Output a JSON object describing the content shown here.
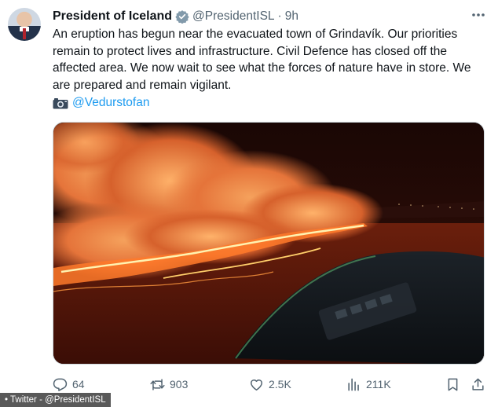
{
  "author": {
    "name": "President of Iceland",
    "handle": "@PresidentISL",
    "separator": "·",
    "time": "9h"
  },
  "tweet": {
    "text": "An eruption has begun near the evacuated town of Grindavík. Our priorities remain to protect lives and infrastructure. Civil Defence has closed off the affected area. We now wait to see what the forces of nature have in store. We are prepared and remain vigilant.",
    "photo_credit": "@Vedurstofan"
  },
  "actions": {
    "replies": "64",
    "reposts": "903",
    "likes": "2.5K",
    "views": "211K"
  },
  "icons": {
    "verified": "verified-badge-icon",
    "more": "more-icon",
    "camera": "camera-icon",
    "reply": "reply-icon",
    "repost": "repost-icon",
    "like": "heart-icon",
    "views": "views-icon",
    "bookmark": "bookmark-icon",
    "share": "share-icon"
  },
  "colors": {
    "link": "#1d9bf0",
    "secondary_text": "#536471",
    "verified": "#829aab"
  },
  "overlay": {
    "credit": "• Twitter - @PresidentISL"
  }
}
